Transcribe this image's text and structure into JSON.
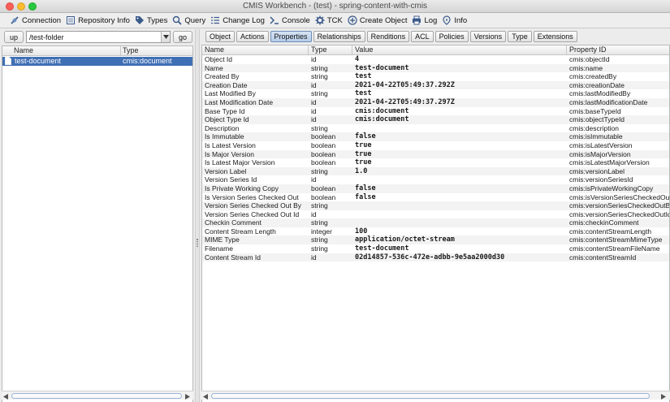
{
  "window": {
    "title": "CMIS Workbench - (test) - spring-content-with-cmis"
  },
  "toolbar": {
    "items": [
      {
        "label": "Connection",
        "icon": "connection-icon"
      },
      {
        "label": "Repository Info",
        "icon": "book-icon"
      },
      {
        "label": "Types",
        "icon": "tag-icon"
      },
      {
        "label": "Query",
        "icon": "search-icon"
      },
      {
        "label": "Change Log",
        "icon": "list-icon"
      },
      {
        "label": "Console",
        "icon": "console-icon"
      },
      {
        "label": "TCK",
        "icon": "gear-icon"
      },
      {
        "label": "Create Object",
        "icon": "plus-icon"
      },
      {
        "label": "Log",
        "icon": "printer-icon"
      },
      {
        "label": "Info",
        "icon": "info-icon"
      }
    ]
  },
  "navigator": {
    "up_label": "up",
    "path_value": "/test-folder",
    "go_label": "go",
    "columns": {
      "name": "Name",
      "type": "Type"
    },
    "rows": [
      {
        "name": "test-document",
        "type": "cmis:document"
      }
    ]
  },
  "details": {
    "tabs": [
      "Object",
      "Actions",
      "Properties",
      "Relationships",
      "Renditions",
      "ACL",
      "Policies",
      "Versions",
      "Type",
      "Extensions"
    ],
    "active_tab": "Properties",
    "columns": {
      "name": "Name",
      "type": "Type",
      "value": "Value",
      "id": "Property ID"
    },
    "rows": [
      {
        "name": "Object Id",
        "type": "id",
        "value": "4",
        "id": "cmis:objectId"
      },
      {
        "name": "Name",
        "type": "string",
        "value": "test-document",
        "id": "cmis:name"
      },
      {
        "name": "Created By",
        "type": "string",
        "value": "test",
        "id": "cmis:createdBy"
      },
      {
        "name": "Creation Date",
        "type": "id",
        "value": "2021-04-22T05:49:37.292Z",
        "id": "cmis:creationDate"
      },
      {
        "name": "Last Modified By",
        "type": "string",
        "value": "test",
        "id": "cmis:lastModifiedBy"
      },
      {
        "name": "Last Modification Date",
        "type": "id",
        "value": "2021-04-22T05:49:37.297Z",
        "id": "cmis:lastModificationDate"
      },
      {
        "name": "Base Type Id",
        "type": "id",
        "value": "cmis:document",
        "id": "cmis:baseTypeId"
      },
      {
        "name": "Object Type Id",
        "type": "id",
        "value": "cmis:document",
        "id": "cmis:objectTypeId"
      },
      {
        "name": "Description",
        "type": "string",
        "value": "",
        "id": "cmis:description"
      },
      {
        "name": "Is Immutable",
        "type": "boolean",
        "value": "false",
        "id": "cmis:isImmutable"
      },
      {
        "name": "Is Latest Version",
        "type": "boolean",
        "value": "true",
        "id": "cmis:isLatestVersion"
      },
      {
        "name": "Is Major Version",
        "type": "boolean",
        "value": "true",
        "id": "cmis:isMajorVersion"
      },
      {
        "name": "Is Latest Major Version",
        "type": "boolean",
        "value": "true",
        "id": "cmis:isLatestMajorVersion"
      },
      {
        "name": "Version Label",
        "type": "string",
        "value": "1.0",
        "id": "cmis:versionLabel"
      },
      {
        "name": "Version Series Id",
        "type": "id",
        "value": "",
        "id": "cmis:versionSeriesId"
      },
      {
        "name": "Is Private Working Copy",
        "type": "boolean",
        "value": "false",
        "id": "cmis:isPrivateWorkingCopy"
      },
      {
        "name": "Is Version Series Checked Out",
        "type": "boolean",
        "value": "false",
        "id": "cmis:isVersionSeriesCheckedOut"
      },
      {
        "name": "Version Series Checked Out By",
        "type": "string",
        "value": "",
        "id": "cmis:versionSeriesCheckedOutBy"
      },
      {
        "name": "Version Series Checked Out Id",
        "type": "id",
        "value": "",
        "id": "cmis:versionSeriesCheckedOutId"
      },
      {
        "name": "Checkin Comment",
        "type": "string",
        "value": "",
        "id": "cmis:checkinComment"
      },
      {
        "name": "Content Stream Length",
        "type": "integer",
        "value": "100",
        "id": "cmis:contentStreamLength"
      },
      {
        "name": "MIME Type",
        "type": "string",
        "value": "application/octet-stream",
        "id": "cmis:contentStreamMimeType"
      },
      {
        "name": "Filename",
        "type": "string",
        "value": "test-document",
        "id": "cmis:contentStreamFileName"
      },
      {
        "name": "Content Stream Id",
        "type": "id",
        "value": "02d14857-536c-472e-adbb-9e5aa2000d30",
        "id": "cmis:contentStreamId"
      }
    ]
  },
  "colors": {
    "selection": "#3f6fb4",
    "active_tab": "#b5cbe8"
  }
}
